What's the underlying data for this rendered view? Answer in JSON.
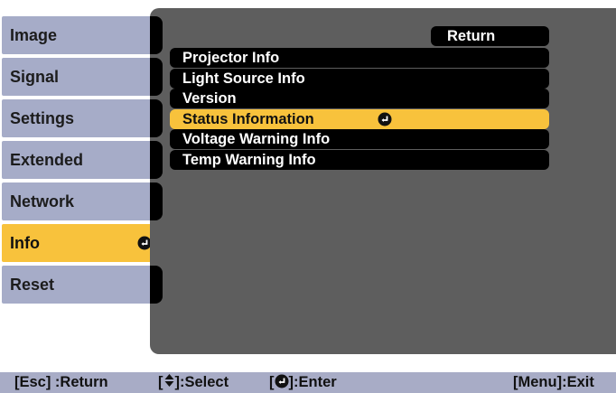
{
  "sidebar": {
    "tabs": [
      {
        "label": "Image"
      },
      {
        "label": "Signal"
      },
      {
        "label": "Settings"
      },
      {
        "label": "Extended"
      },
      {
        "label": "Network"
      },
      {
        "label": "Info",
        "active": true
      },
      {
        "label": "Reset"
      }
    ]
  },
  "menu": {
    "return_label": "Return",
    "items": [
      {
        "label": "Projector Info"
      },
      {
        "label": "Light Source Info"
      },
      {
        "label": "Version"
      },
      {
        "label": "Status Information",
        "selected": true
      },
      {
        "label": "Voltage Warning Info"
      },
      {
        "label": "Temp Warning Info"
      }
    ]
  },
  "helpbar": {
    "esc": "[Esc] :Return",
    "select_open": "[",
    "select": "]:Select",
    "enter_open": "[",
    "enter": "]:Enter",
    "exit": "[Menu]:Exit"
  },
  "colors": {
    "accent": "#f8c23c",
    "tab_bg": "#a6acc8",
    "panel_bg": "#5e5e5e",
    "item_bg": "#000000",
    "helpbar_bg": "#a8acc6"
  },
  "icons": {
    "enter": "enter-icon",
    "updown": "up-down-arrow-icon"
  }
}
